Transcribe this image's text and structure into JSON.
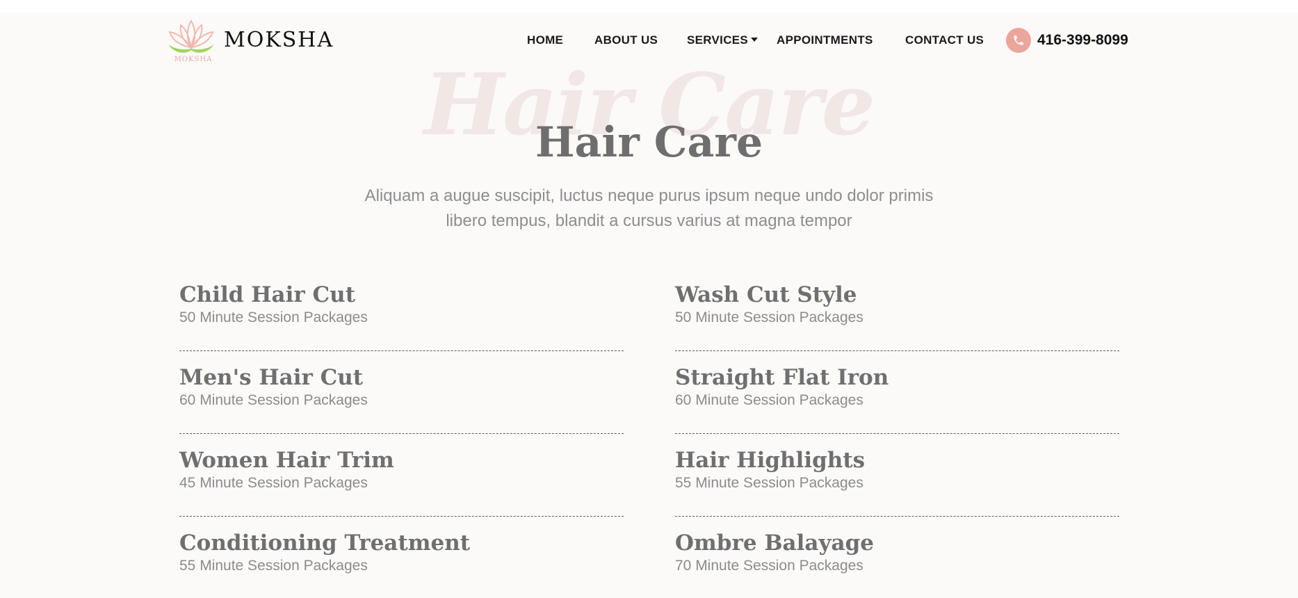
{
  "brand": {
    "name": "MOKSHA",
    "logo_caption": "MOKSHA",
    "logo_icon": "lotus-icon",
    "colors": {
      "lotus": "#f2b8b0",
      "leaf": "#9ed65a"
    }
  },
  "nav": {
    "items": [
      {
        "label": "HOME"
      },
      {
        "label": "ABOUT US"
      },
      {
        "label": "SERVICES",
        "has_dropdown": true
      },
      {
        "label": "APPOINTMENTS"
      },
      {
        "label": "CONTACT US"
      }
    ],
    "phone": "416-399-8099",
    "phone_icon": "phone-icon",
    "accent": "#eca59b"
  },
  "hero": {
    "script_text": "Hair Care",
    "title": "Hair Care",
    "subtitle": "Aliquam a augue suscipit, luctus neque purus ipsum neque undo dolor primis libero tempus, blandit a cursus varius at magna tempor"
  },
  "services": {
    "left": [
      {
        "name": "Child Hair Cut",
        "desc": "50 Minute Session Packages"
      },
      {
        "name": "Men's Hair Cut",
        "desc": "60 Minute Session Packages"
      },
      {
        "name": "Women Hair Trim",
        "desc": "45 Minute Session Packages"
      },
      {
        "name": "Conditioning Treatment",
        "desc": "55 Minute Session Packages"
      }
    ],
    "right": [
      {
        "name": "Wash Cut Style",
        "desc": "50 Minute Session Packages"
      },
      {
        "name": "Straight Flat Iron",
        "desc": "60 Minute Session Packages"
      },
      {
        "name": "Hair Highlights",
        "desc": "55 Minute Session Packages"
      },
      {
        "name": "Ombre Balayage",
        "desc": "70 Minute Session Packages"
      }
    ]
  }
}
